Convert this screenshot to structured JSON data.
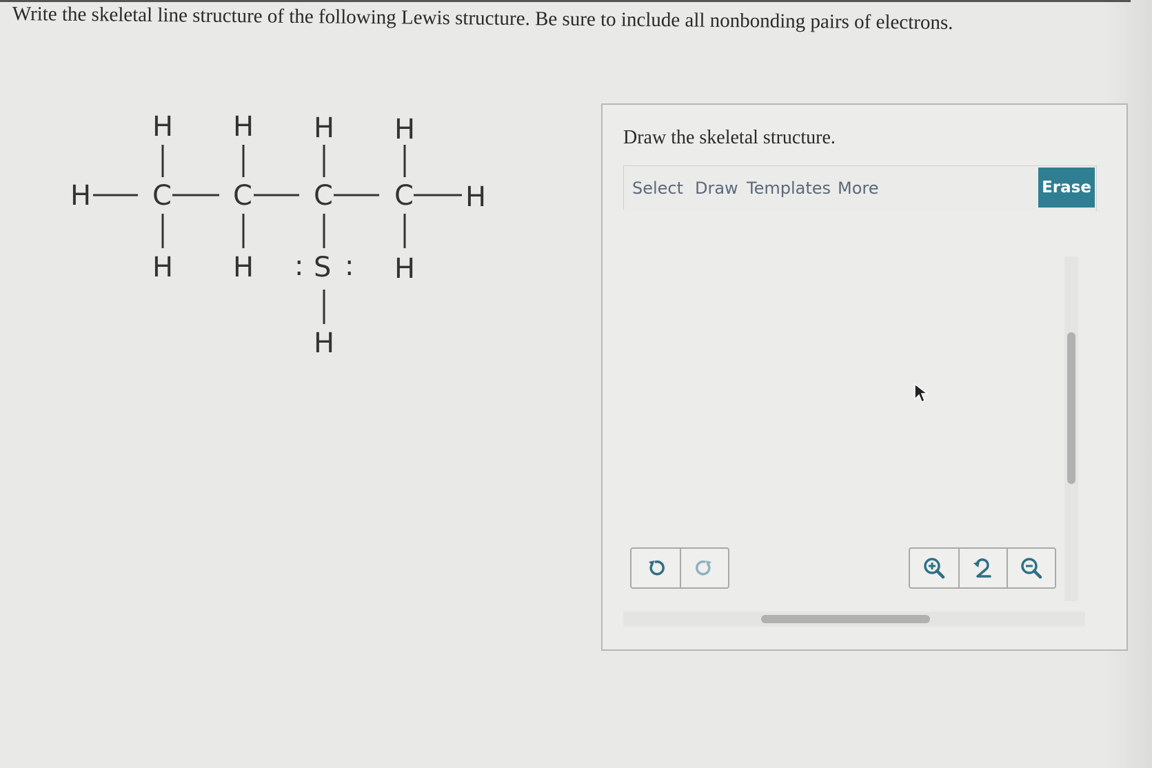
{
  "question": {
    "text": "Write the skeletal line structure of the following Lewis structure. Be sure to include all nonbonding pairs of electrons."
  },
  "lewis_structure": {
    "atoms": {
      "hydrogen": "H",
      "carbon": "C",
      "sulfur": "S",
      "lone_pair": ":"
    }
  },
  "panel": {
    "title": "Draw the skeletal structure.",
    "toolbar": {
      "select": "Select",
      "draw": "Draw",
      "templates": "Templates",
      "more": "More",
      "erase": "Erase"
    }
  },
  "icons": {
    "undo": "undo-icon",
    "redo": "redo-icon",
    "zoom_in": "zoom-in-icon",
    "zoom_reset": "zoom-reset-icon",
    "zoom_out": "zoom-out-icon"
  },
  "colors": {
    "accent": "#2f7e91",
    "icon": "#2f6f86"
  }
}
